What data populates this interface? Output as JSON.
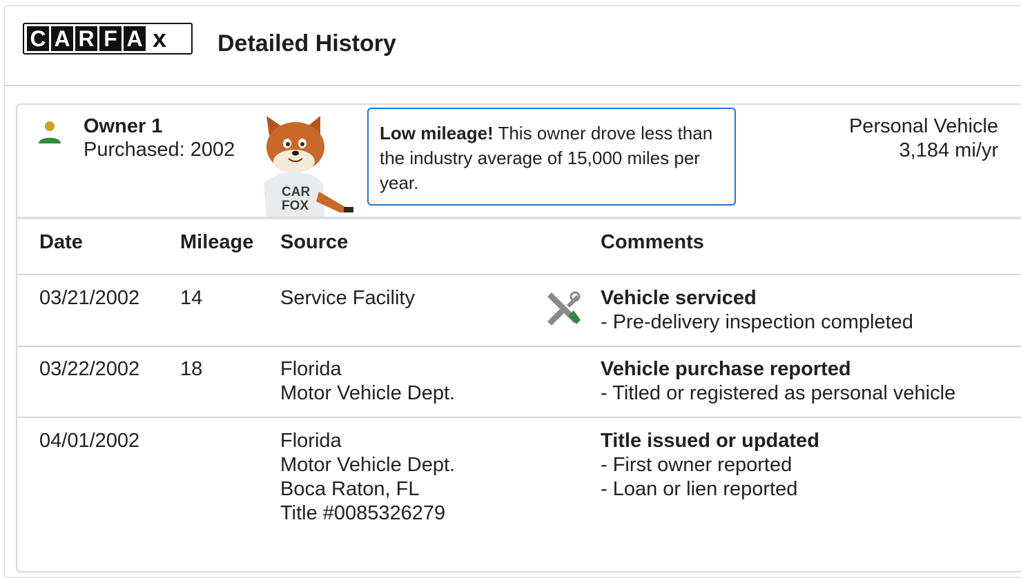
{
  "header": {
    "logo_letters": [
      "C",
      "A",
      "R",
      "F",
      "A",
      "x"
    ],
    "title": "Detailed History"
  },
  "owner": {
    "name": "Owner 1",
    "purchased": "Purchased: 2002",
    "mascot_shirt": [
      "CAR",
      "FOX"
    ],
    "callout_bold": "Low mileage!",
    "callout_text": " This owner drove less than the industry average of 15,000 miles per year.",
    "vehicle_type": "Personal Vehicle",
    "mileage_rate": "3,184 mi/yr"
  },
  "colors": {
    "accent_blue": "#1e78c8",
    "owner_icon_head": "#c9a227",
    "owner_icon_body": "#2e8b3e",
    "tool_green": "#2e8b3e",
    "tool_gray": "#8a8a8a"
  },
  "table": {
    "headers": {
      "date": "Date",
      "mileage": "Mileage",
      "source": "Source",
      "comments": "Comments"
    },
    "rows": [
      {
        "date": "03/21/2002",
        "mileage": "14",
        "source": [
          "Service Facility"
        ],
        "icon": "service-tools-icon",
        "comment_title": "Vehicle serviced",
        "comments": [
          "- Pre-delivery inspection completed"
        ]
      },
      {
        "date": "03/22/2002",
        "mileage": "18",
        "source": [
          "Florida",
          "Motor Vehicle Dept."
        ],
        "comment_title": "Vehicle purchase reported",
        "comments": [
          "- Titled or registered as personal vehicle"
        ]
      },
      {
        "date": "04/01/2002",
        "mileage": "",
        "source": [
          "Florida",
          "Motor Vehicle Dept.",
          "Boca Raton, FL",
          "Title #0085326279"
        ],
        "comment_title": "Title issued or updated",
        "comments": [
          "- First owner reported",
          "- Loan or lien reported"
        ]
      }
    ]
  }
}
